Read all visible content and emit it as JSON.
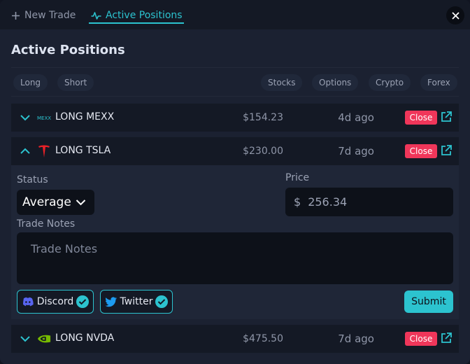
{
  "tabs": [
    {
      "label": "New Trade",
      "icon": "plus-icon",
      "active": false
    },
    {
      "label": "Active Positions",
      "icon": "pulse-icon",
      "active": true
    }
  ],
  "page_title": "Active Positions",
  "filters": {
    "direction": [
      "Long",
      "Short"
    ],
    "asset_class": [
      "Stocks",
      "Options",
      "Crypto",
      "Forex"
    ]
  },
  "positions": [
    {
      "side_symbol": "LONG MEXX",
      "logo": "mexx-logo",
      "price": "$154.23",
      "age": "4d ago",
      "close_label": "Close",
      "expanded": false
    },
    {
      "side_symbol": "LONG TSLA",
      "logo": "tesla-logo",
      "price": "$230.00",
      "age": "7d ago",
      "close_label": "Close",
      "expanded": true
    },
    {
      "side_symbol": "LONG NVDA",
      "logo": "nvidia-logo",
      "price": "$475.50",
      "age": "7d ago",
      "close_label": "Close",
      "expanded": false
    }
  ],
  "detail": {
    "status_label": "Status",
    "status_value": "Average",
    "price_label": "Price",
    "currency_symbol": "$",
    "price_value": "256.34",
    "notes_label": "Trade Notes",
    "notes_placeholder": "Trade Notes",
    "share": [
      {
        "label": "Discord",
        "icon": "discord-icon",
        "checked": true
      },
      {
        "label": "Twitter",
        "icon": "twitter-icon",
        "checked": true
      }
    ],
    "submit_label": "Submit"
  },
  "colors": {
    "accent": "#2cc3cf",
    "close": "#f0365a",
    "tesla": "#e82127",
    "nvidia": "#76b900"
  }
}
